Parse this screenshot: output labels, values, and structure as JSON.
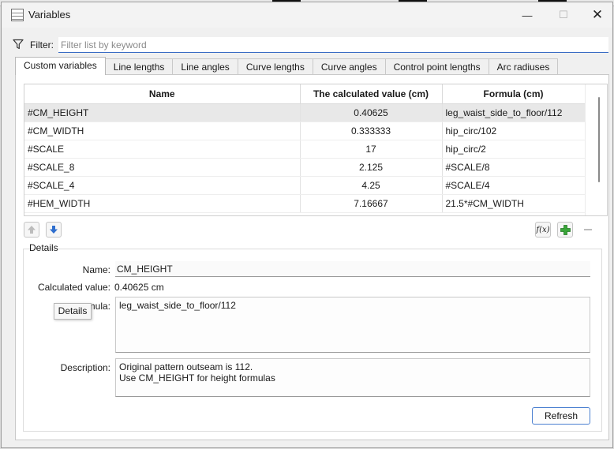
{
  "window": {
    "title": "Variables",
    "minimize_icon": "minimize-icon",
    "maximize_icon": "maximize-icon",
    "close_icon": "close-icon"
  },
  "filter": {
    "label": "Filter:",
    "placeholder": "Filter list by keyword",
    "value": ""
  },
  "tabs": [
    {
      "label": "Custom variables",
      "active": true
    },
    {
      "label": "Line lengths",
      "active": false
    },
    {
      "label": "Line angles",
      "active": false
    },
    {
      "label": "Curve lengths",
      "active": false
    },
    {
      "label": "Curve angles",
      "active": false
    },
    {
      "label": "Control point lengths",
      "active": false
    },
    {
      "label": "Arc radiuses",
      "active": false
    }
  ],
  "table": {
    "columns": [
      "Name",
      "The calculated value (cm)",
      "Formula (cm)"
    ],
    "rows": [
      {
        "name": "#CM_HEIGHT",
        "value": "0.40625",
        "formula": "leg_waist_side_to_floor/112",
        "selected": true
      },
      {
        "name": "#CM_WIDTH",
        "value": "0.333333",
        "formula": "hip_circ/102",
        "selected": false
      },
      {
        "name": "#SCALE",
        "value": "17",
        "formula": "hip_circ/2",
        "selected": false
      },
      {
        "name": "#SCALE_8",
        "value": "2.125",
        "formula": "#SCALE/8",
        "selected": false
      },
      {
        "name": "#SCALE_4",
        "value": "4.25",
        "formula": "#SCALE/4",
        "selected": false
      },
      {
        "name": "#HEM_WIDTH",
        "value": "7.16667",
        "formula": "21.5*#CM_WIDTH",
        "selected": false
      }
    ]
  },
  "toolbar": {
    "move_up_icon": "arrow-up-icon",
    "move_down_icon": "arrow-down-icon",
    "function_icon_label": "f(x)",
    "add_icon": "plus-icon",
    "remove_icon": "minus-icon"
  },
  "details": {
    "group_label": "Details",
    "name_label": "Name:",
    "name_value": "CM_HEIGHT",
    "calc_label": "Calculated value:",
    "calc_value": "0.40625 cm",
    "formula_label_visible": "rmula:",
    "formula_value": "leg_waist_side_to_floor/112",
    "tooltip": "Details",
    "description_label": "Description:",
    "description_line1": "Original pattern outseam is 112.",
    "description_line2": "Use CM_HEIGHT for height formulas",
    "refresh_label": "Refresh"
  },
  "colors": {
    "accent": "#3a6cc4",
    "selected_row": "#e8e8e8",
    "add_green": "#3aa63a",
    "arrow_blue": "#2f6fce"
  }
}
